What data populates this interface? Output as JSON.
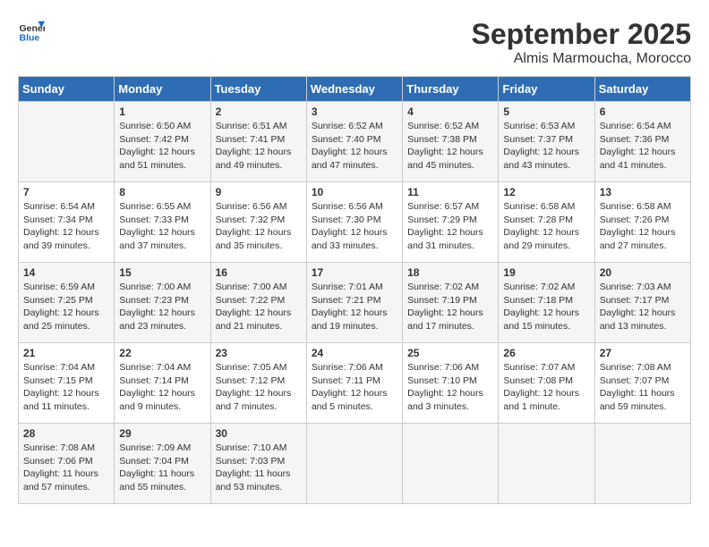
{
  "header": {
    "logo_line1": "General",
    "logo_line2": "Blue",
    "month": "September 2025",
    "location": "Almis Marmoucha, Morocco"
  },
  "weekdays": [
    "Sunday",
    "Monday",
    "Tuesday",
    "Wednesday",
    "Thursday",
    "Friday",
    "Saturday"
  ],
  "weeks": [
    [
      {
        "day": "",
        "info": ""
      },
      {
        "day": "1",
        "info": "Sunrise: 6:50 AM\nSunset: 7:42 PM\nDaylight: 12 hours\nand 51 minutes."
      },
      {
        "day": "2",
        "info": "Sunrise: 6:51 AM\nSunset: 7:41 PM\nDaylight: 12 hours\nand 49 minutes."
      },
      {
        "day": "3",
        "info": "Sunrise: 6:52 AM\nSunset: 7:40 PM\nDaylight: 12 hours\nand 47 minutes."
      },
      {
        "day": "4",
        "info": "Sunrise: 6:52 AM\nSunset: 7:38 PM\nDaylight: 12 hours\nand 45 minutes."
      },
      {
        "day": "5",
        "info": "Sunrise: 6:53 AM\nSunset: 7:37 PM\nDaylight: 12 hours\nand 43 minutes."
      },
      {
        "day": "6",
        "info": "Sunrise: 6:54 AM\nSunset: 7:36 PM\nDaylight: 12 hours\nand 41 minutes."
      }
    ],
    [
      {
        "day": "7",
        "info": "Sunrise: 6:54 AM\nSunset: 7:34 PM\nDaylight: 12 hours\nand 39 minutes."
      },
      {
        "day": "8",
        "info": "Sunrise: 6:55 AM\nSunset: 7:33 PM\nDaylight: 12 hours\nand 37 minutes."
      },
      {
        "day": "9",
        "info": "Sunrise: 6:56 AM\nSunset: 7:32 PM\nDaylight: 12 hours\nand 35 minutes."
      },
      {
        "day": "10",
        "info": "Sunrise: 6:56 AM\nSunset: 7:30 PM\nDaylight: 12 hours\nand 33 minutes."
      },
      {
        "day": "11",
        "info": "Sunrise: 6:57 AM\nSunset: 7:29 PM\nDaylight: 12 hours\nand 31 minutes."
      },
      {
        "day": "12",
        "info": "Sunrise: 6:58 AM\nSunset: 7:28 PM\nDaylight: 12 hours\nand 29 minutes."
      },
      {
        "day": "13",
        "info": "Sunrise: 6:58 AM\nSunset: 7:26 PM\nDaylight: 12 hours\nand 27 minutes."
      }
    ],
    [
      {
        "day": "14",
        "info": "Sunrise: 6:59 AM\nSunset: 7:25 PM\nDaylight: 12 hours\nand 25 minutes."
      },
      {
        "day": "15",
        "info": "Sunrise: 7:00 AM\nSunset: 7:23 PM\nDaylight: 12 hours\nand 23 minutes."
      },
      {
        "day": "16",
        "info": "Sunrise: 7:00 AM\nSunset: 7:22 PM\nDaylight: 12 hours\nand 21 minutes."
      },
      {
        "day": "17",
        "info": "Sunrise: 7:01 AM\nSunset: 7:21 PM\nDaylight: 12 hours\nand 19 minutes."
      },
      {
        "day": "18",
        "info": "Sunrise: 7:02 AM\nSunset: 7:19 PM\nDaylight: 12 hours\nand 17 minutes."
      },
      {
        "day": "19",
        "info": "Sunrise: 7:02 AM\nSunset: 7:18 PM\nDaylight: 12 hours\nand 15 minutes."
      },
      {
        "day": "20",
        "info": "Sunrise: 7:03 AM\nSunset: 7:17 PM\nDaylight: 12 hours\nand 13 minutes."
      }
    ],
    [
      {
        "day": "21",
        "info": "Sunrise: 7:04 AM\nSunset: 7:15 PM\nDaylight: 12 hours\nand 11 minutes."
      },
      {
        "day": "22",
        "info": "Sunrise: 7:04 AM\nSunset: 7:14 PM\nDaylight: 12 hours\nand 9 minutes."
      },
      {
        "day": "23",
        "info": "Sunrise: 7:05 AM\nSunset: 7:12 PM\nDaylight: 12 hours\nand 7 minutes."
      },
      {
        "day": "24",
        "info": "Sunrise: 7:06 AM\nSunset: 7:11 PM\nDaylight: 12 hours\nand 5 minutes."
      },
      {
        "day": "25",
        "info": "Sunrise: 7:06 AM\nSunset: 7:10 PM\nDaylight: 12 hours\nand 3 minutes."
      },
      {
        "day": "26",
        "info": "Sunrise: 7:07 AM\nSunset: 7:08 PM\nDaylight: 12 hours\nand 1 minute."
      },
      {
        "day": "27",
        "info": "Sunrise: 7:08 AM\nSunset: 7:07 PM\nDaylight: 11 hours\nand 59 minutes."
      }
    ],
    [
      {
        "day": "28",
        "info": "Sunrise: 7:08 AM\nSunset: 7:06 PM\nDaylight: 11 hours\nand 57 minutes."
      },
      {
        "day": "29",
        "info": "Sunrise: 7:09 AM\nSunset: 7:04 PM\nDaylight: 11 hours\nand 55 minutes."
      },
      {
        "day": "30",
        "info": "Sunrise: 7:10 AM\nSunset: 7:03 PM\nDaylight: 11 hours\nand 53 minutes."
      },
      {
        "day": "",
        "info": ""
      },
      {
        "day": "",
        "info": ""
      },
      {
        "day": "",
        "info": ""
      },
      {
        "day": "",
        "info": ""
      }
    ]
  ]
}
